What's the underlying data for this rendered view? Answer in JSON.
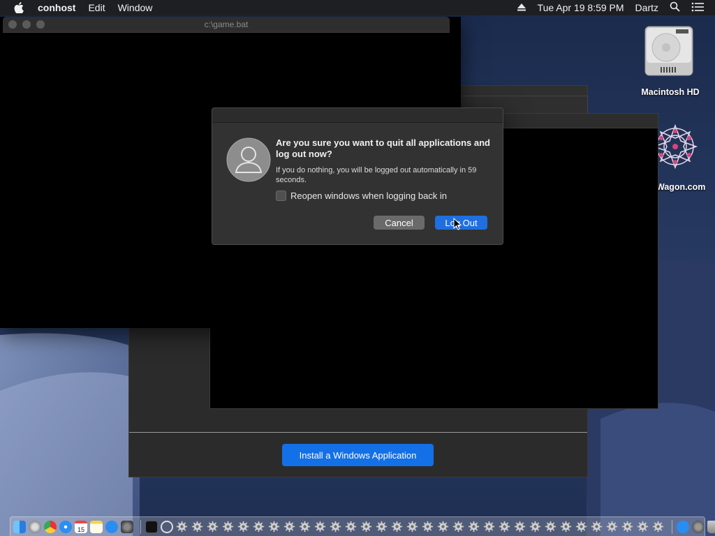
{
  "menubar": {
    "app_name": "conhost",
    "menus": [
      "Edit",
      "Window"
    ],
    "date_time": "Tue Apr 19  8:59 PM",
    "user": "Dartz",
    "icons": [
      "apple-icon",
      "eject-icon",
      "spotlight-search-icon",
      "notification-center-icon"
    ]
  },
  "console_window": {
    "title": "c:\\game.bat"
  },
  "desktop": {
    "icons": [
      {
        "label": "Macintosh HD",
        "icon": "hard-drive-icon"
      },
      {
        "label": "Wagon.com",
        "icon": "wagon-logo-icon"
      }
    ]
  },
  "background_window": {
    "install_button": "Install a Windows Application"
  },
  "logout_dialog": {
    "heading": "Are you sure you want to quit all applications and log out now?",
    "message": "If you do nothing, you will be logged out automatically in 59 seconds.",
    "checkbox_label": "Reopen windows when logging back in",
    "checkbox_checked": false,
    "cancel_label": "Cancel",
    "logout_label": "Log Out",
    "accent_color": "#1f6fe0"
  },
  "dock": {
    "apps": [
      "finder-icon",
      "launchpad-icon",
      "chrome-icon",
      "safari-icon",
      "calendar-icon",
      "notes-icon",
      "app-store-icon",
      "system-preferences-icon"
    ],
    "running": [
      "terminal-icon",
      "wineskin-icon"
    ],
    "gear_app_count": 32,
    "trailing": [
      "app-store-downloads-icon",
      "settings-icon",
      "trash-icon"
    ],
    "calendar_day": "15"
  }
}
